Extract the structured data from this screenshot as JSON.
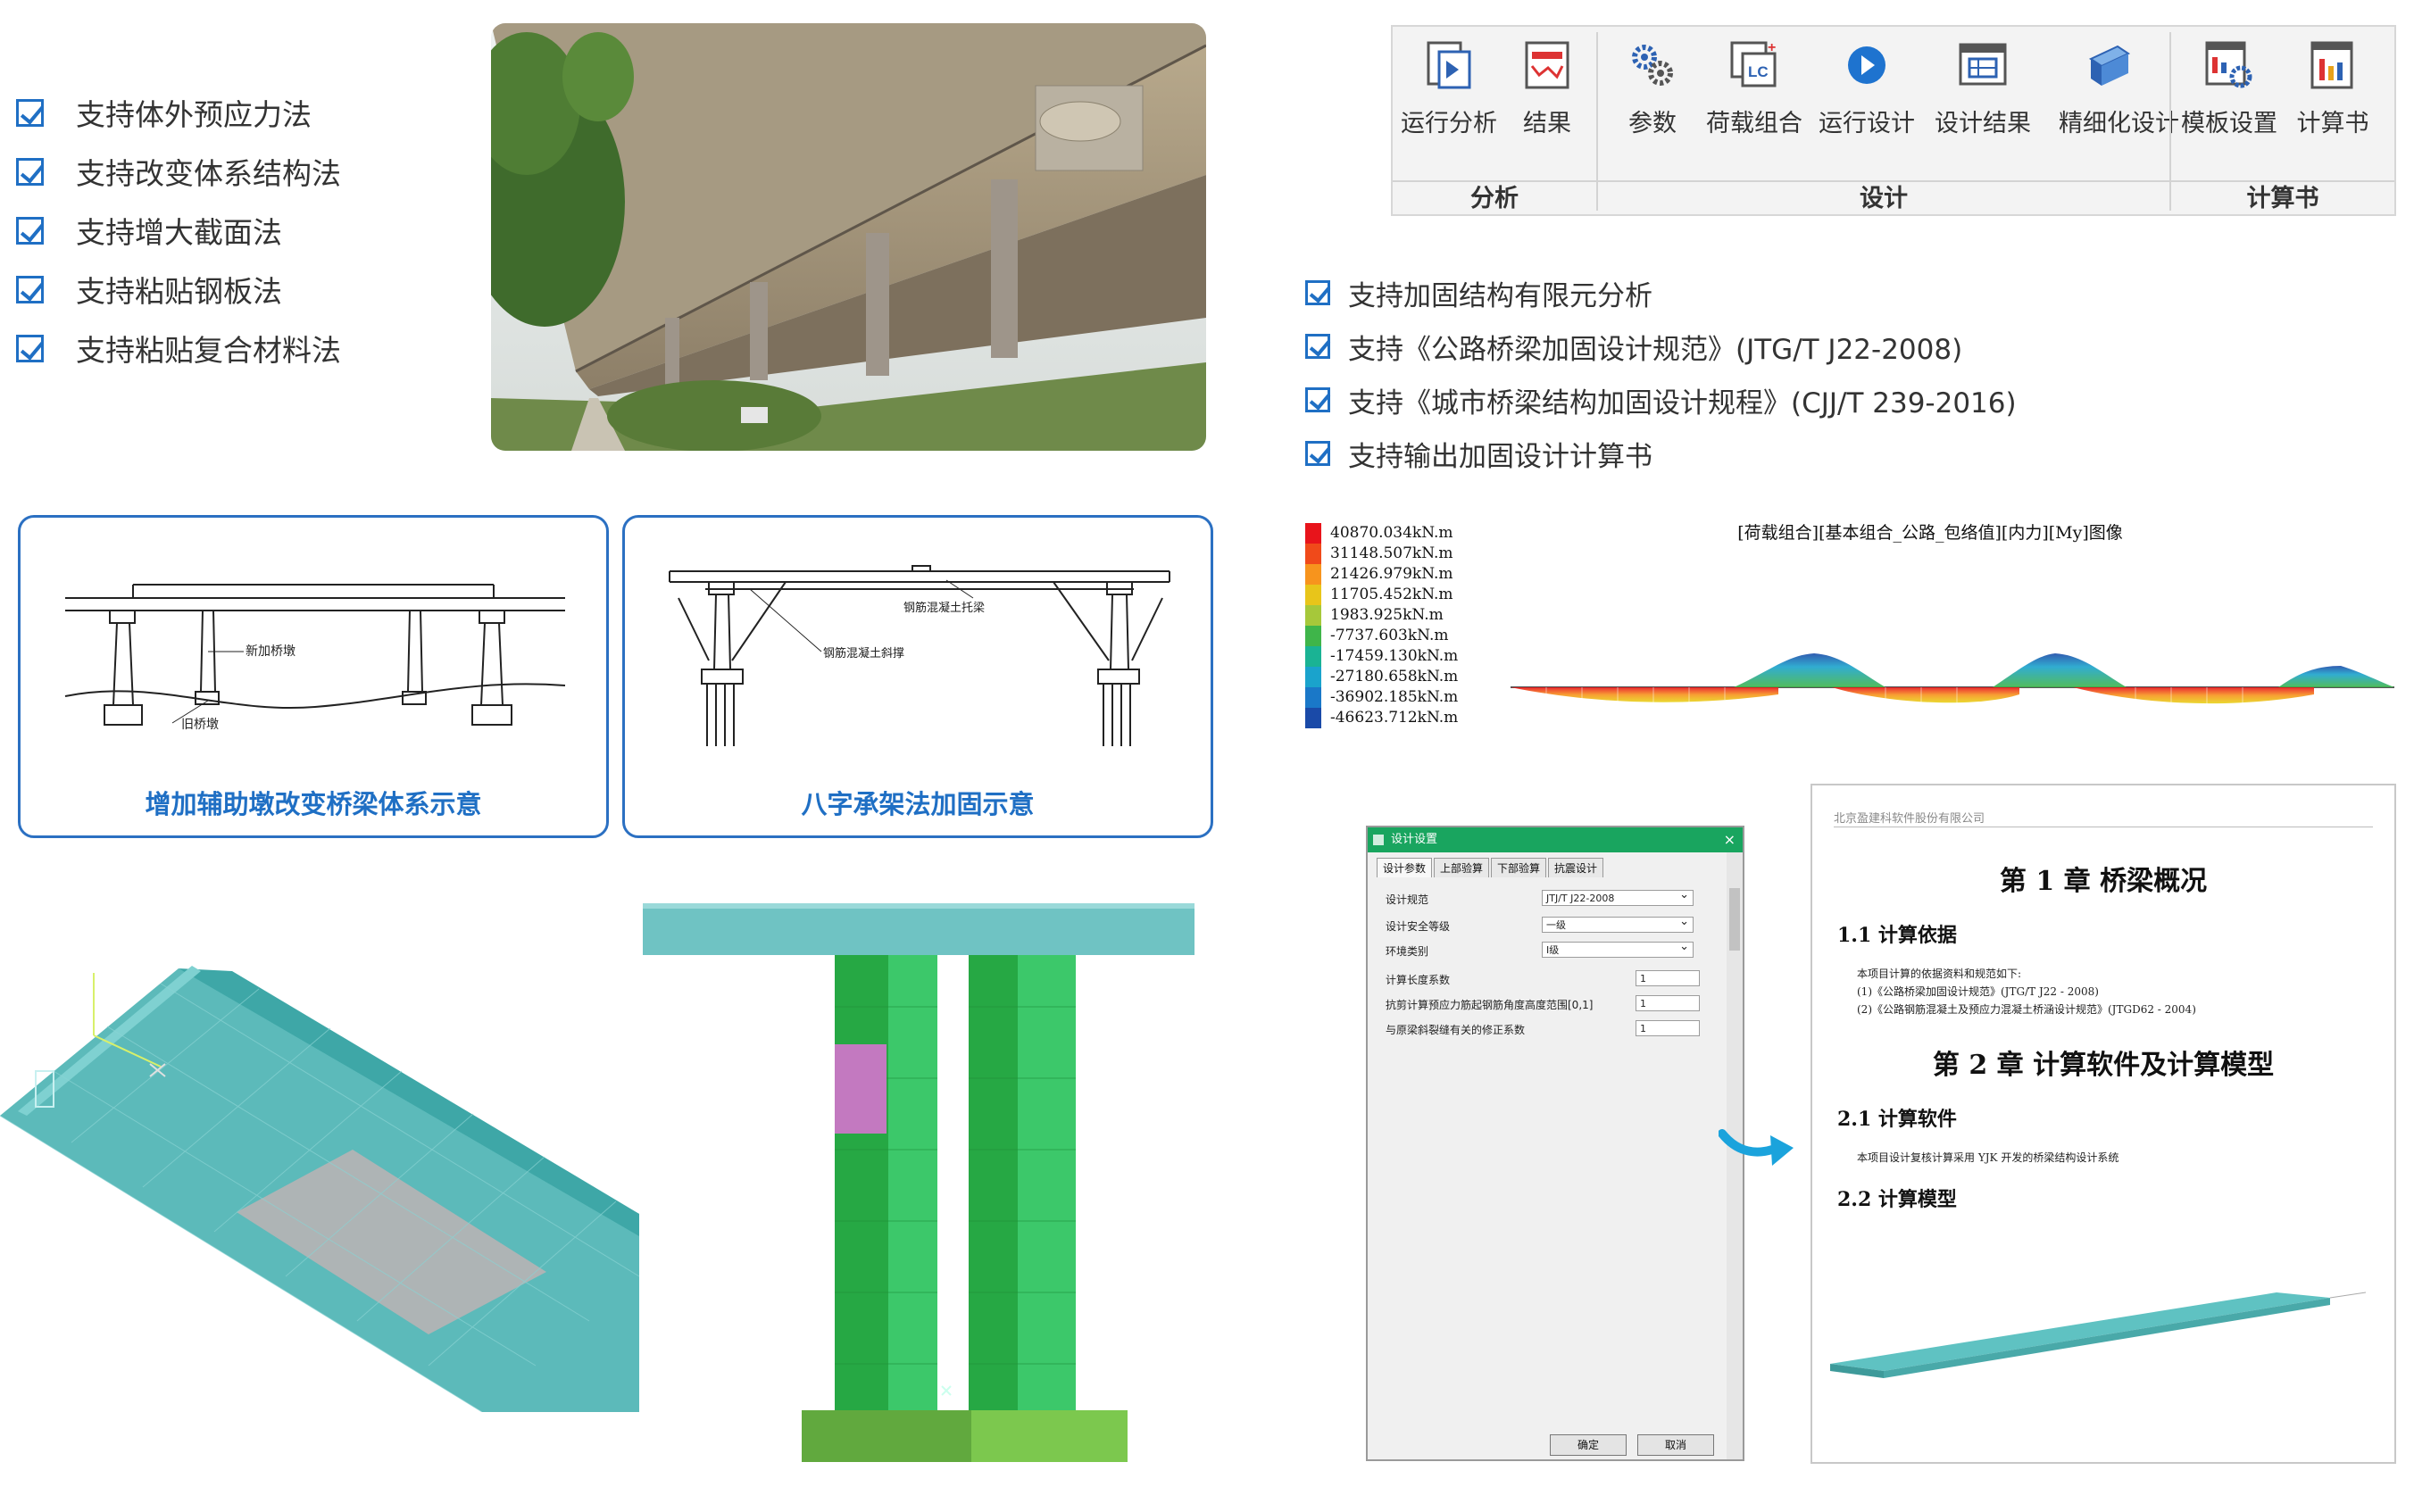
{
  "left_features": [
    "支持体外预应力法",
    "支持改变体系结构法",
    "支持增大截面法",
    "支持粘贴钢板法",
    "支持粘贴复合材料法"
  ],
  "ribbon": {
    "groups": [
      {
        "label": "分析",
        "buttons": [
          "运行分析",
          "结果"
        ]
      },
      {
        "label": "设计",
        "buttons": [
          "参数",
          "荷载组合",
          "运行设计",
          "设计结果",
          "精细化设计"
        ]
      },
      {
        "label": "计算书",
        "buttons": [
          "模板设置",
          "计算书"
        ]
      }
    ]
  },
  "right_features": [
    "支持加固结构有限元分析",
    "支持《公路桥梁加固设计规范》(JTG/T J22-2008)",
    "支持《城市桥梁结构加固设计规程》(CJJ/T 239-2016)",
    "支持输出加固设计计算书"
  ],
  "diagram1": {
    "caption": "增加辅助墩改变桥梁体系示意",
    "labels": [
      "新加桥墩",
      "旧桥墩"
    ]
  },
  "diagram2": {
    "caption": "八字承架法加固示意",
    "labels": [
      "钢筋混凝土托梁",
      "钢筋混凝土斜撑"
    ]
  },
  "moment_diagram": {
    "title": "[荷载组合][基本组合_公路_包络值][内力][My]图像",
    "legend": [
      {
        "value": "40870.034kN.m",
        "color": "#e8141b"
      },
      {
        "value": "31148.507kN.m",
        "color": "#f04a1a"
      },
      {
        "value": "21426.979kN.m",
        "color": "#f7941d"
      },
      {
        "value": "11705.452kN.m",
        "color": "#e8c51a"
      },
      {
        "value": "1983.925kN.m",
        "color": "#a6c83a"
      },
      {
        "value": "-7737.603kN.m",
        "color": "#3fb54a"
      },
      {
        "value": "-17459.130kN.m",
        "color": "#1ab394"
      },
      {
        "value": "-27180.658kN.m",
        "color": "#1aa3cc"
      },
      {
        "value": "-36902.185kN.m",
        "color": "#1a78c8"
      },
      {
        "value": "-46623.712kN.m",
        "color": "#1a4aa8"
      }
    ]
  },
  "dialog": {
    "title": "设计设置",
    "tabs": [
      "设计参数",
      "上部验算",
      "下部验算",
      "抗震设计"
    ],
    "rows": [
      {
        "label": "设计规范",
        "value": "JTJ/T J22-2008"
      },
      {
        "label": "设计安全等级",
        "value": "一级"
      },
      {
        "label": "环境类别",
        "value": "I级"
      }
    ],
    "inputs": [
      {
        "label": "计算长度系数",
        "value": "1"
      },
      {
        "label": "抗剪计算预应力筋起钢筋角度高度范围[0,1]",
        "value": "1"
      },
      {
        "label": "与原梁斜裂缝有关的修正系数",
        "value": "1"
      }
    ],
    "ok": "确定",
    "cancel": "取消"
  },
  "report": {
    "company": "北京盈建科软件股份有限公司",
    "ch1": "第 1 章  桥梁概况",
    "s11": "1.1 计算依据",
    "p1": "本项目计算的依据资料和规范如下:",
    "p2": "(1)《公路桥梁加固设计规范》(JTG/T J22 - 2008)",
    "p3": "(2)《公路钢筋混凝土及预应力混凝土桥涵设计规范》(JTGD62 - 2004)",
    "ch2": "第 2 章  计算软件及计算模型",
    "s21": "2.1 计算软件",
    "p4": "本项目设计复核计算采用 YJK 开发的桥梁结构设计系统",
    "s22": "2.2 计算模型"
  }
}
